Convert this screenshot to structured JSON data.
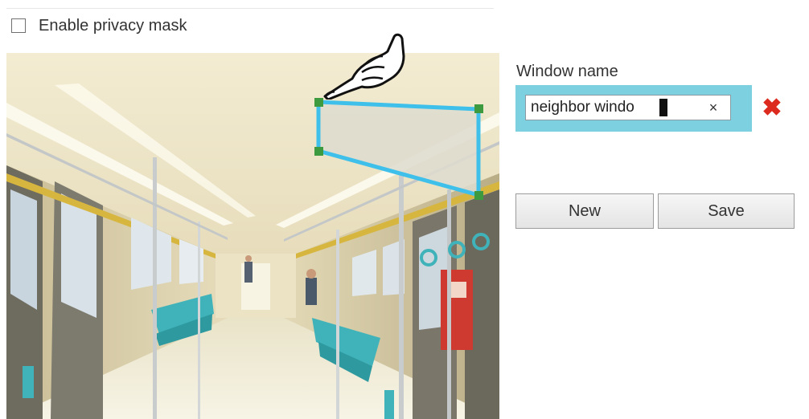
{
  "privacy": {
    "enable_label": "Enable privacy mask",
    "enabled": false
  },
  "window": {
    "name_label": "Window name",
    "name_value": "neighbor windo",
    "clear_glyph": "×",
    "delete_glyph": "✖"
  },
  "buttons": {
    "new_label": "New",
    "save_label": "Save"
  },
  "colors": {
    "mask_outline": "#3fc0ea",
    "mask_handle": "#3e9a3e",
    "name_panel": "#7dd0e0",
    "delete": "#dd2a1f"
  },
  "icons": {
    "pointer": "hand-pointer-icon",
    "delete": "red-x-icon",
    "clear": "clear-x-icon"
  }
}
